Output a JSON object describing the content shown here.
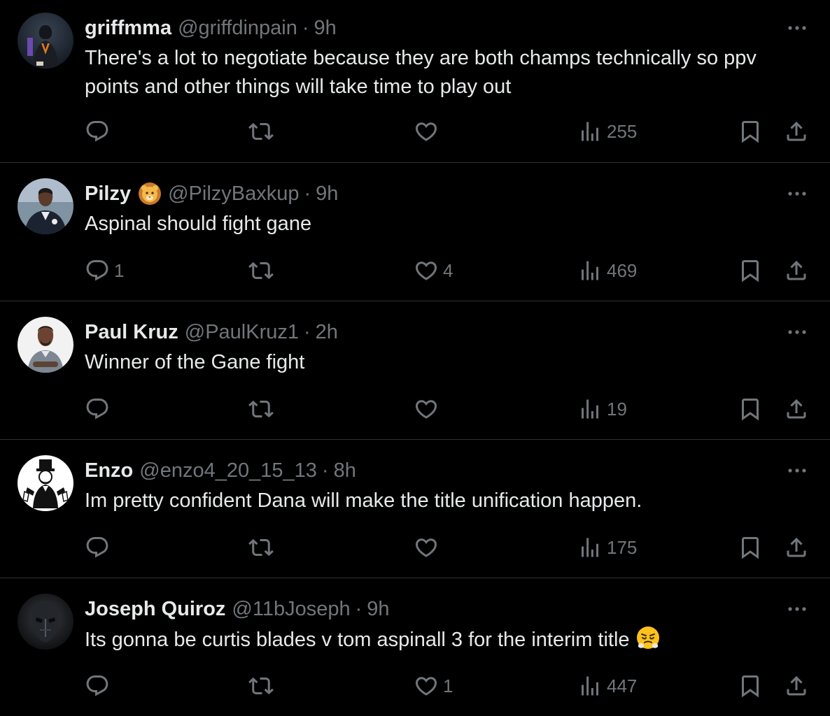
{
  "colors": {
    "background": "#000000",
    "primary_text": "#e7e9ea",
    "secondary_text": "#71767b",
    "divider": "#2f3336"
  },
  "tweets": [
    {
      "name": "griffmma",
      "handle": "@griffdinpain",
      "separator": "·",
      "time": "9h",
      "text": "There's a lot to negotiate because they are both champs technically so ppv points and other things will take time to play out",
      "replies": "",
      "retweets": "",
      "likes": "",
      "views": "255",
      "avatar_icon": "avatar-dark-figure-icon"
    },
    {
      "name": "Pilzy",
      "handle": "@PilzyBaxkup",
      "separator": "·",
      "time": "9h",
      "text": "Aspinal should fight gane",
      "replies": "1",
      "retweets": "",
      "likes": "4",
      "views": "469",
      "badge_icon": "lion-emoji-icon",
      "avatar_icon": "avatar-coach-icon"
    },
    {
      "name": "Paul Kruz",
      "handle": "@PaulKruz1",
      "separator": "·",
      "time": "2h",
      "text": "Winner of the Gane fight",
      "replies": "",
      "retweets": "",
      "likes": "",
      "views": "19",
      "avatar_icon": "avatar-man-icon"
    },
    {
      "name": "Enzo",
      "handle": "@enzo4_20_15_13",
      "separator": "·",
      "time": "8h",
      "text": "Im pretty confident Dana will make the title unification happen.",
      "replies": "",
      "retweets": "",
      "likes": "",
      "views": "175",
      "avatar_icon": "avatar-monopoly-man-icon"
    },
    {
      "name": "Joseph Quiroz",
      "handle": "@11bJoseph",
      "separator": "·",
      "time": "9h",
      "text": "Its gonna be curtis blades v tom aspinall 3 for the interim title",
      "replies": "",
      "retweets": "",
      "likes": "1",
      "views": "447",
      "trailing_emoji": "steaming-face-emoji-icon",
      "avatar_icon": "avatar-masked-face-icon"
    }
  ]
}
